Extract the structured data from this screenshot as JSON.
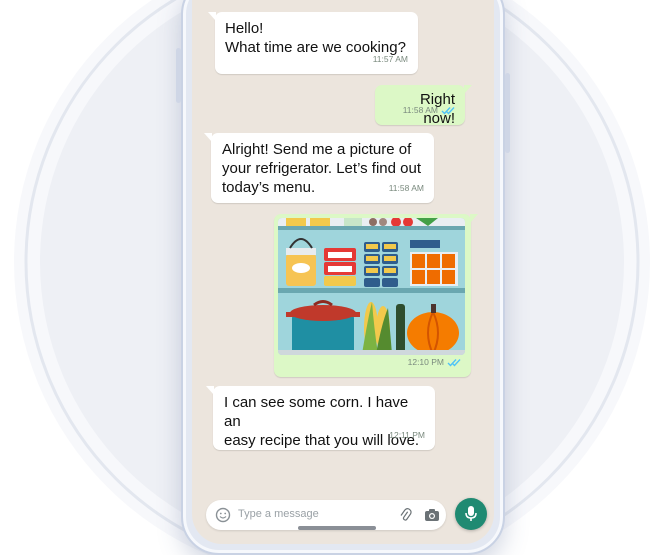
{
  "chat": {
    "messages": [
      {
        "direction": "in",
        "text": "Hello!\nWhat time are we cooking?",
        "time": "11:57 AM"
      },
      {
        "direction": "out",
        "text": "Right now!",
        "time": "11:58 AM",
        "read": true
      },
      {
        "direction": "in",
        "text": "Alright! Send me a picture of\nyour refrigerator. Let’s find out\ntoday’s menu.",
        "time": "11:58 AM"
      },
      {
        "direction": "out",
        "type": "image",
        "image": "refrigerator-photo",
        "time": "12:10 PM",
        "read": true
      },
      {
        "direction": "in",
        "text": "I can see some corn. I have an\neasy recipe that you will love.",
        "time": "12:11 PM"
      }
    ]
  },
  "composer": {
    "placeholder": "Type a message",
    "icons": [
      "emoji-icon",
      "attach-icon",
      "camera-icon",
      "mic-icon"
    ]
  },
  "colors": {
    "chat_background": "#ece5dd",
    "incoming_bubble": "#ffffff",
    "outgoing_bubble": "#dcf8c6",
    "read_receipt": "#4fc3f7",
    "mic_button": "#1f8a72"
  }
}
